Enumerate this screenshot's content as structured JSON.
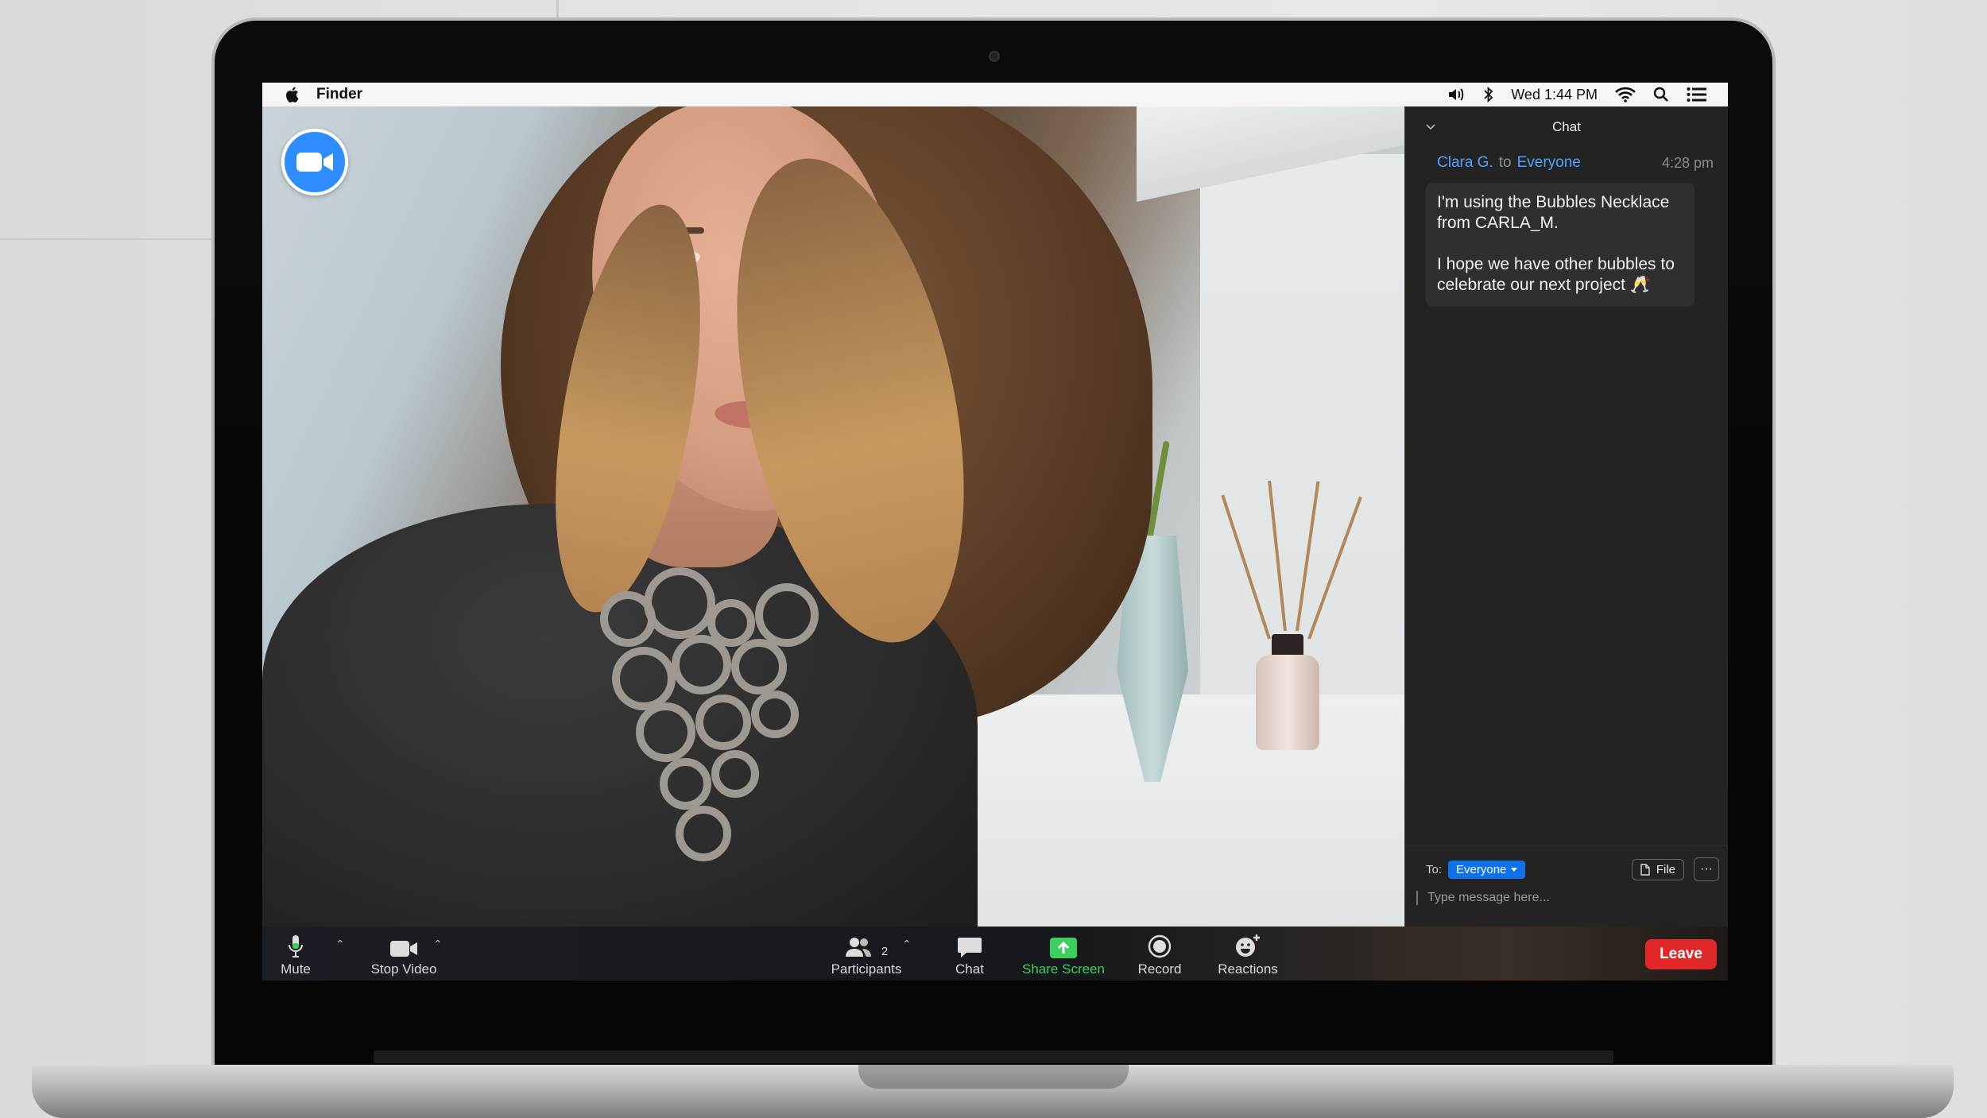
{
  "menubar": {
    "app_name": "Finder",
    "clock": "Wed 1:44 PM"
  },
  "chat": {
    "title": "Chat",
    "message": {
      "sender": "Clara G.",
      "to_word": "to",
      "recipient": "Everyone",
      "time": "4:28 pm",
      "paragraph_1": "I'm using the Bubbles Necklace from CARLA_M.",
      "paragraph_2": "I hope we have other bubbles to celebrate our next project 🥂"
    },
    "footer": {
      "to_label": "To:",
      "to_value": "Everyone",
      "file_label": "File",
      "more_label": "···",
      "input_placeholder": "Type message here..."
    }
  },
  "toolbar": {
    "mute": "Mute",
    "stop_video": "Stop Video",
    "participants": "Participants",
    "participants_count": "2",
    "chat": "Chat",
    "share_screen": "Share Screen",
    "record": "Record",
    "reactions": "Reactions",
    "leave": "Leave"
  },
  "colors": {
    "zoom_blue": "#2d8cff",
    "share_green": "#3ccf5c",
    "leave_red": "#e02828",
    "link_blue": "#4ea3ff",
    "chat_panel_bg": "#232323"
  }
}
